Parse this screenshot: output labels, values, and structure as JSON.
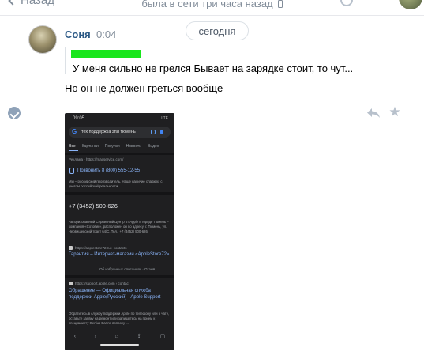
{
  "header": {
    "back_label": "Назад",
    "status": "была в сети три часа назад"
  },
  "date_divider": "сегодня",
  "message": {
    "author": "Соня",
    "time": "0:04",
    "quote_text": "У меня сильно не грелся Бывает на зарядке стоит, то чут...",
    "text": "Но он не должен греться вообще"
  },
  "screenshot": {
    "status_time": "09:05",
    "status_right": "LTE",
    "query": "тех поддержка эпл тюмень",
    "tabs": [
      "Все",
      "Картинки",
      "Покупки",
      "Новости",
      "Видео"
    ],
    "ad_label": "Реклама · https://macservice.com/",
    "call_link": "Позвонить 8 (800) 555-12-55",
    "ad_desc": "Мы – российский производитель. Наше наличие сладких, с учетом российской реальности.",
    "phone_big": "+7 (3452) 500-626",
    "snippet": "Авторизованный Сервисный Центр от Apple в городе Тюмень – компания «Сотовик», расположен он по адресу: г. Тюмень, ул. Червишевский тракт 64/С. Тел.: +7 (3452) 500-626",
    "result1_url": "https://applestore72.ru › contacts",
    "result1_title": "Гарантия – Интернет-магазин «AppleStore72»",
    "result1_meta": "Об избранных описаниях · Отзыв",
    "result2_url": "https://support.apple.com › contact",
    "result2_title": "Обращение — Официальная служба поддержки Apple(Русский) - Apple Support",
    "result2_desc": "Обратитесь в службу поддержки Apple по телефону или в чате, оставьте заявку на ремонт или запишитесь на прием к специалисту Genius Bar по вопросу ..."
  },
  "icons": [
    "back-chevron-icon",
    "phone-icon",
    "check-icon",
    "reply-icon",
    "star-icon"
  ]
}
